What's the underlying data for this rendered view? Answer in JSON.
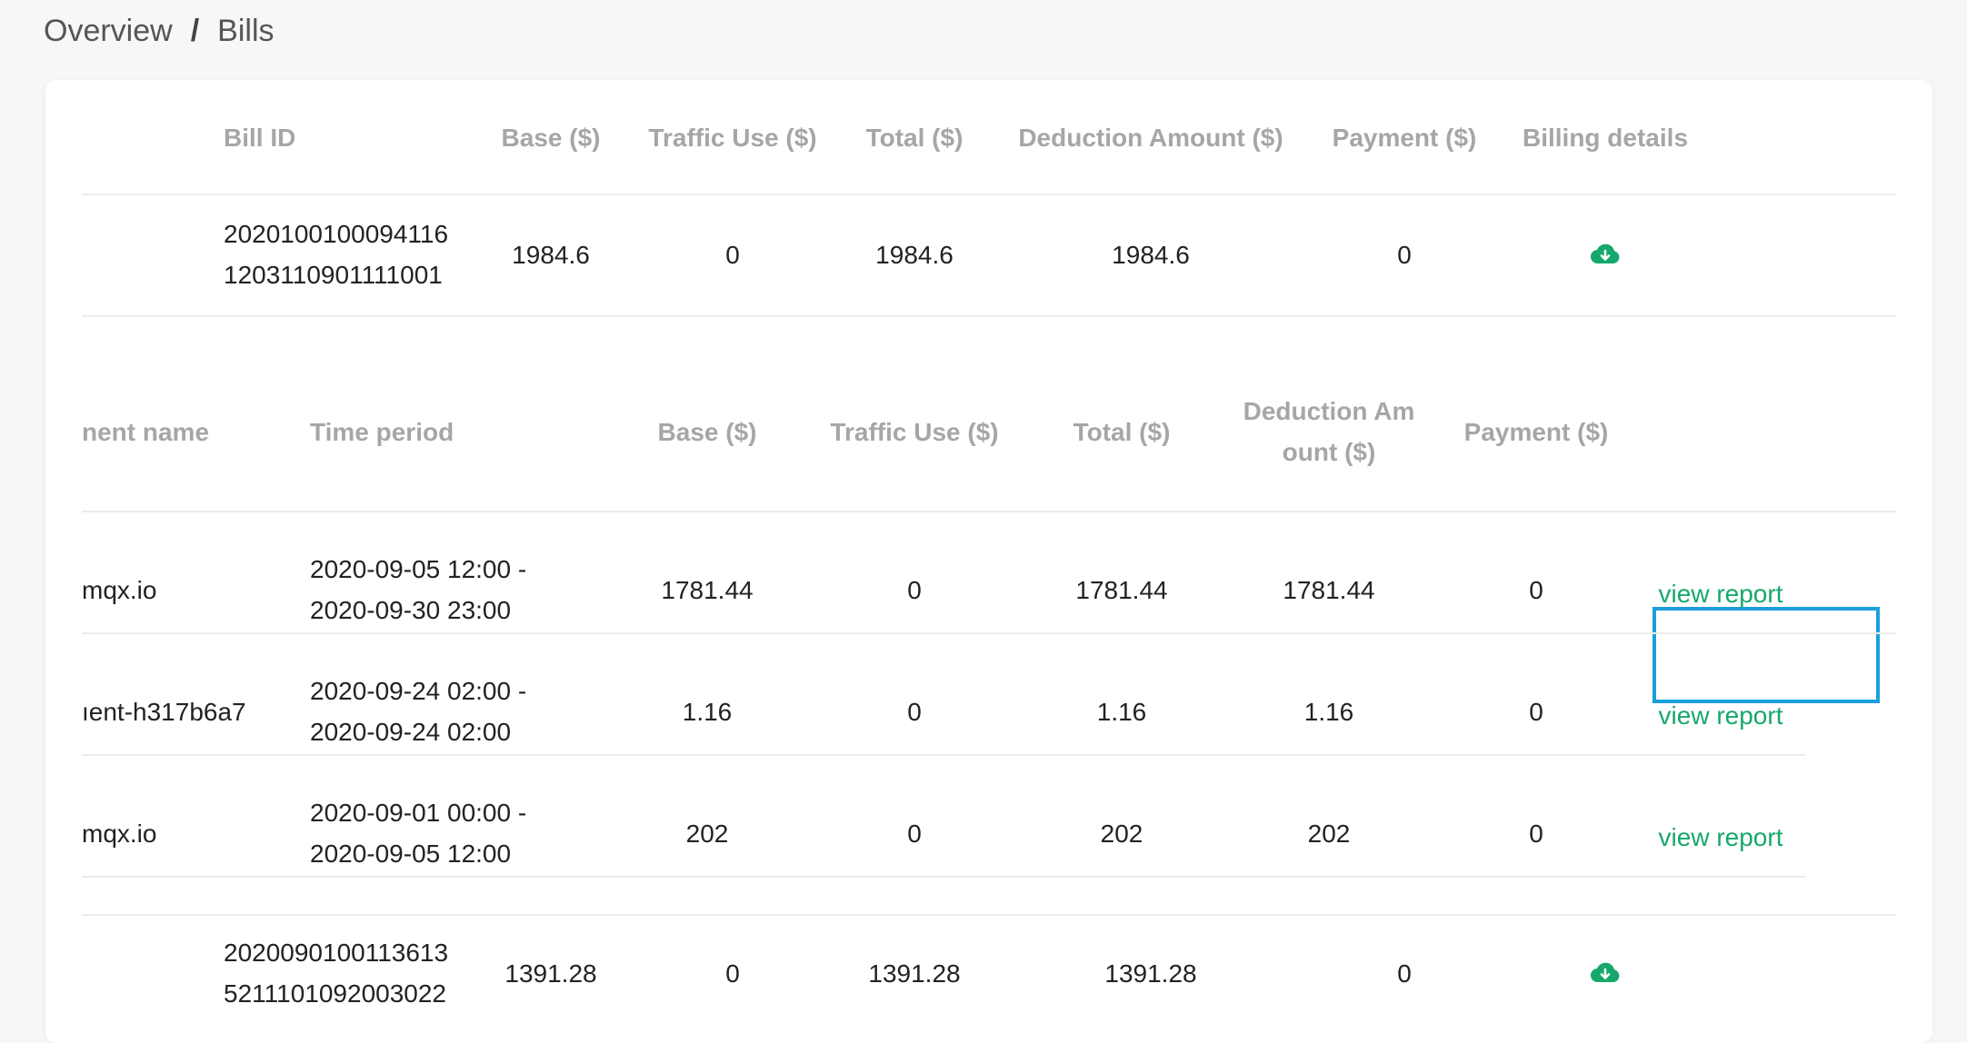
{
  "breadcrumb": {
    "root": "Overview",
    "separator": "/",
    "current": "Bills"
  },
  "bills_table": {
    "headers": {
      "bill_id": "Bill ID",
      "base": "Base ($)",
      "traffic": "Traffic Use ($)",
      "total": "Total ($)",
      "deduction": "Deduction Amount ($)",
      "payment": "Payment ($)",
      "details": "Billing details"
    },
    "rows": [
      {
        "bill_id_line1": "2020100100094116",
        "bill_id_line2": "1203110901111001",
        "base": "1984.6",
        "traffic": "0",
        "total": "1984.6",
        "deduction": "1984.6",
        "payment": "0",
        "details_icon": "cloud-download-icon"
      },
      {
        "bill_id_line1": "2020090100113613",
        "bill_id_line2": "5211101092003022",
        "base": "1391.28",
        "traffic": "0",
        "total": "1391.28",
        "deduction": "1391.28",
        "payment": "0",
        "details_icon": "cloud-download-icon"
      }
    ]
  },
  "deployments_table": {
    "headers": {
      "name": "nent name",
      "period": "Time period",
      "base": "Base ($)",
      "traffic": "Traffic Use ($)",
      "total": "Total ($)",
      "deduction_line1": "Deduction Am",
      "deduction_line2": "ount ($)",
      "payment": "Payment ($)"
    },
    "rows": [
      {
        "name": "mqx.io",
        "period_line1": "2020-09-05 12:00 -",
        "period_line2": "2020-09-30 23:00",
        "base": "1781.44",
        "traffic": "0",
        "total": "1781.44",
        "deduction": "1781.44",
        "payment": "0",
        "action": "view report"
      },
      {
        "name": "ıent-h317b6a7",
        "period_line1": "2020-09-24 02:00 -",
        "period_line2": "2020-09-24 02:00",
        "base": "1.16",
        "traffic": "0",
        "total": "1.16",
        "deduction": "1.16",
        "payment": "0",
        "action": "view report"
      },
      {
        "name": "mqx.io",
        "period_line1": "2020-09-01 00:00 -",
        "period_line2": "2020-09-05 12:00",
        "base": "202",
        "traffic": "0",
        "total": "202",
        "deduction": "202",
        "payment": "0",
        "action": "view report"
      }
    ]
  },
  "colors": {
    "accent": "#16a86a",
    "focus": "#1a9fdc",
    "header_text": "#a6a6a6"
  }
}
